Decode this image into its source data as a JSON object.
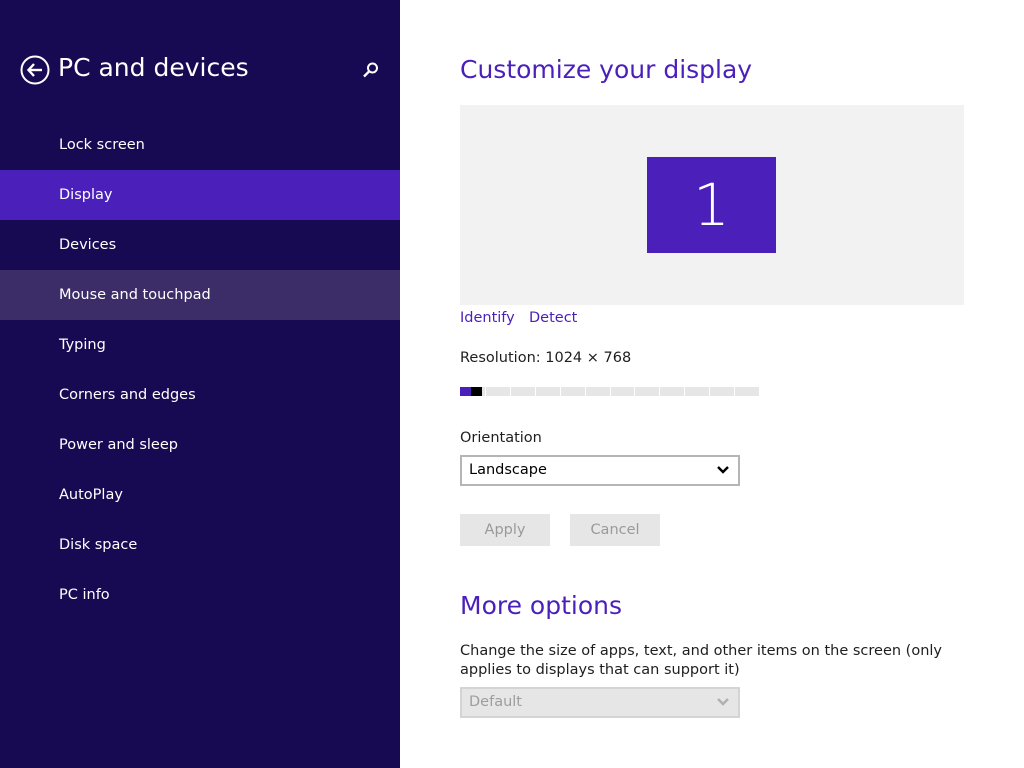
{
  "sidebar": {
    "title": "PC and devices",
    "back_icon": "back-arrow-circle-icon",
    "search_icon": "search-icon",
    "items": [
      {
        "label": "Lock screen",
        "state": "normal"
      },
      {
        "label": "Display",
        "state": "selected"
      },
      {
        "label": "Devices",
        "state": "normal"
      },
      {
        "label": "Mouse and touchpad",
        "state": "hover"
      },
      {
        "label": "Typing",
        "state": "normal"
      },
      {
        "label": "Corners and edges",
        "state": "normal"
      },
      {
        "label": "Power and sleep",
        "state": "normal"
      },
      {
        "label": "AutoPlay",
        "state": "normal"
      },
      {
        "label": "Disk space",
        "state": "normal"
      },
      {
        "label": "PC info",
        "state": "normal"
      }
    ]
  },
  "main": {
    "title": "Customize your display",
    "monitor_number": "1",
    "identify_label": "Identify",
    "detect_label": "Detect",
    "resolution_label": "Resolution: 1024 × 768",
    "resolution_slider": {
      "position": 0,
      "steps": 12
    },
    "orientation_label": "Orientation",
    "orientation_value": "Landscape",
    "apply_label": "Apply",
    "cancel_label": "Cancel",
    "more_options_title": "More options",
    "size_description": "Change the size of apps, text, and other items on the screen (only applies to displays that can support it)",
    "size_value": "Default"
  },
  "colors": {
    "sidebar_bg": "#180a52",
    "accent": "#4a1fba",
    "hover": "#3c2d69",
    "button_bg": "#e6e6e6"
  }
}
